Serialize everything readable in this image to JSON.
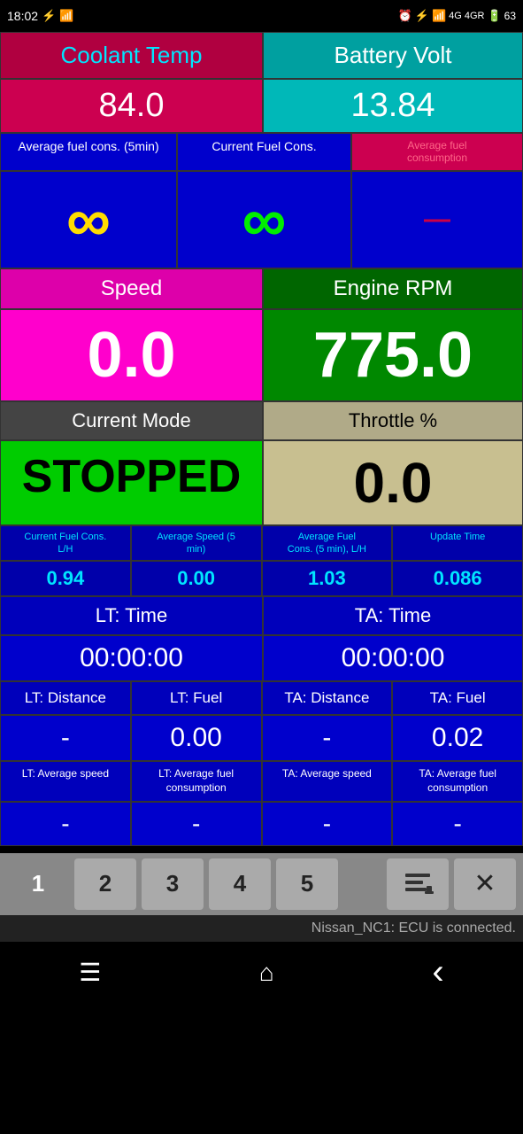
{
  "statusBar": {
    "time": "18:02",
    "icons": "wifi signal battery"
  },
  "coolant": {
    "header": "Coolant Temp",
    "value": "84.0"
  },
  "battery": {
    "header": "Battery Volt",
    "value": "13.84"
  },
  "fuelRow": {
    "avgFuelLabel": "Average fuel cons. (5min)",
    "currentFuelLabel": "Current Fuel Cons.",
    "avgFuelConsLabel": "Average fuel\nconsumption",
    "inf1": "∞",
    "inf2": "∞",
    "dash": "—"
  },
  "speed": {
    "label": "Speed",
    "value": "0.0"
  },
  "rpm": {
    "label": "Engine RPM",
    "value": "775.0"
  },
  "mode": {
    "label": "Current Mode",
    "value": "STOPPED"
  },
  "throttle": {
    "label": "Throttle %",
    "value": "0.0"
  },
  "smallStats": {
    "labels": [
      "Current Fuel Cons.\nL/H",
      "Average Speed (5\nmin)",
      "Average Fuel\nCons. (5 min), L/H",
      "Update Time"
    ],
    "values": [
      "0.94",
      "0.00",
      "1.03",
      "0.086"
    ]
  },
  "ltTime": {
    "label": "LT: Time",
    "value": "00:00:00"
  },
  "taTime": {
    "label": "TA: Time",
    "value": "00:00:00"
  },
  "distFuel": {
    "labels": [
      "LT: Distance",
      "LT: Fuel",
      "TA: Distance",
      "TA: Fuel"
    ],
    "values": [
      "-",
      "0.00",
      "-",
      "0.02"
    ]
  },
  "avgStats": {
    "labels": [
      "LT: Average speed",
      "LT: Average fuel\nconsumption",
      "TA: Average speed",
      "TA: Average fuel\nconsumption"
    ],
    "values": [
      "-",
      "-",
      "-",
      "-"
    ]
  },
  "tabs": {
    "buttons": [
      "1",
      "2",
      "3",
      "4",
      "5"
    ],
    "active": "1"
  },
  "connectionStatus": "Nissan_NC1: ECU is connected.",
  "navBar": {
    "menu": "☰",
    "home": "⌂",
    "back": "‹"
  }
}
